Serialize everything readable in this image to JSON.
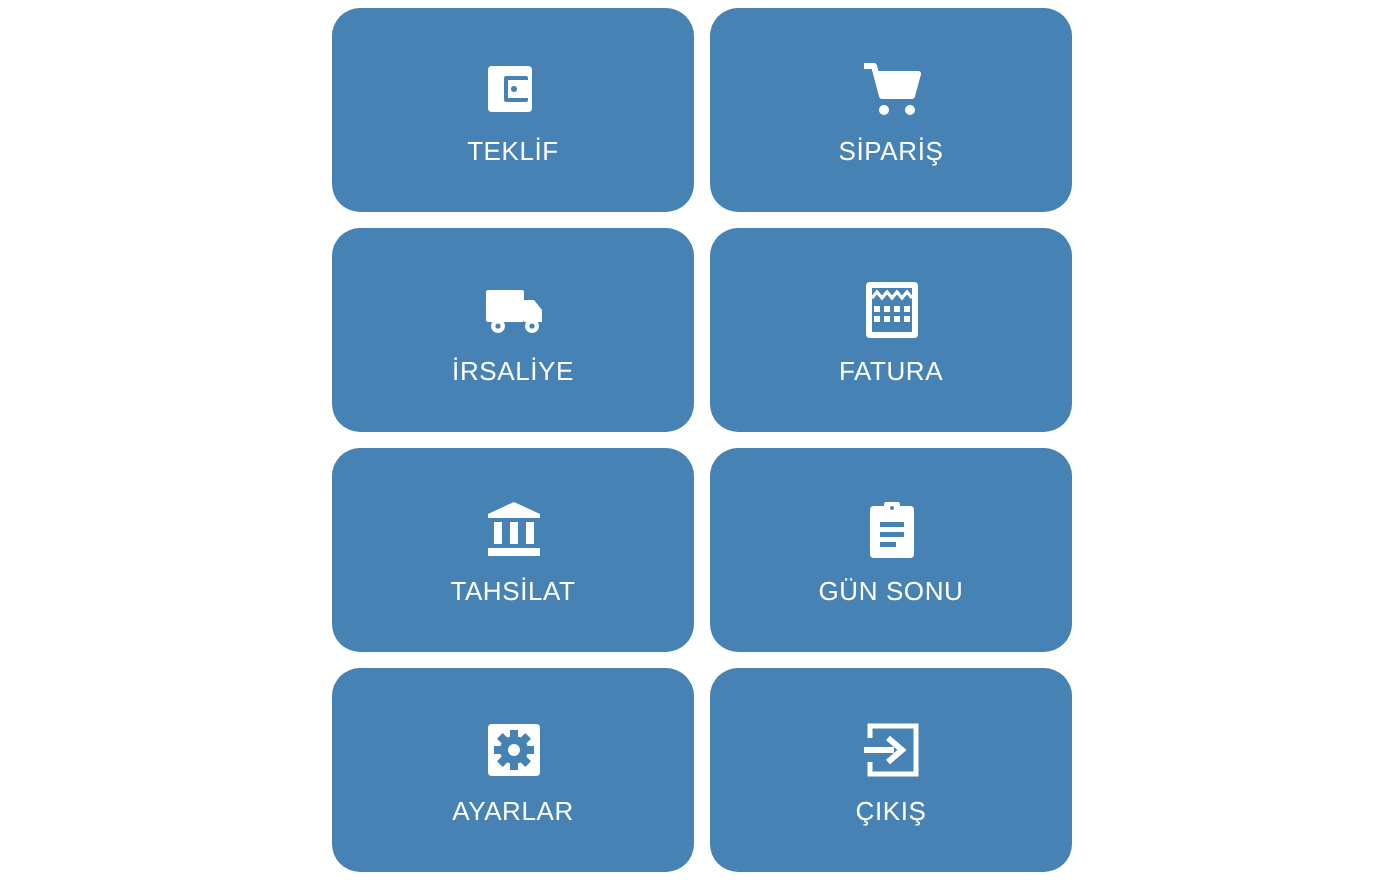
{
  "menu": [
    {
      "label": "TEKLİF"
    },
    {
      "label": "SİPARİŞ"
    },
    {
      "label": "İRSALİYE"
    },
    {
      "label": "FATURA"
    },
    {
      "label": "TAHSİLAT"
    },
    {
      "label": "GÜN SONU"
    },
    {
      "label": "AYARLAR"
    },
    {
      "label": "ÇIKIŞ"
    }
  ]
}
